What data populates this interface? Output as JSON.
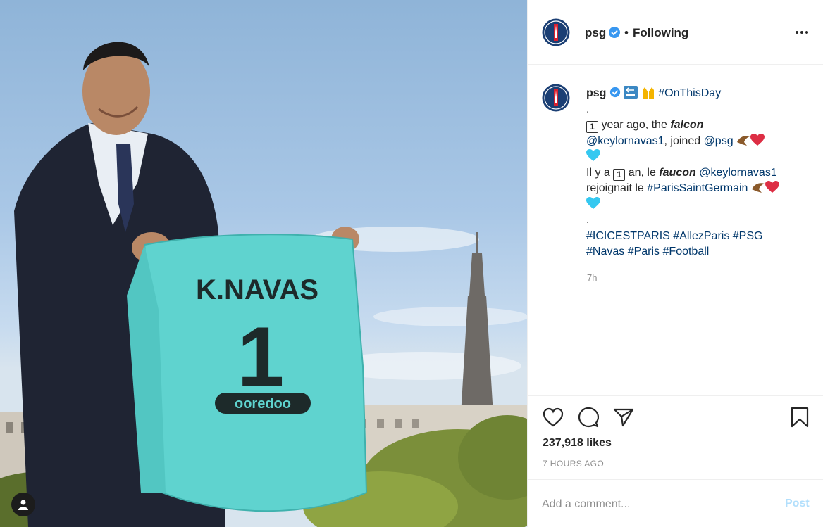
{
  "post": {
    "username": "psg",
    "follow_status": "Following",
    "more_label": "More options",
    "user_tag_label": "Tagged user"
  },
  "photo": {
    "jersey_name": "K.NAVAS",
    "jersey_number": "1",
    "jersey_sponsor": "ooredoo",
    "avatar_text": "PARIS"
  },
  "caption": {
    "username": "psg",
    "back_emoji": "back-arrow-emoji",
    "hands_emoji": "raised-hands-emoji",
    "hashtag_day": "#OnThisDay",
    "dot1": ".",
    "keycap": "1",
    "line2_a": "year ago, the",
    "falcon": "falcon",
    "mention1": "@keylornavas1",
    "line3_b": ", joined",
    "mention_psg": "@psg",
    "fr_a": "Il y a",
    "fr_b": "an, le",
    "faucon": "faucon",
    "mention2": "@keylornavas1",
    "fr_c": "rejoignait le",
    "hashtag_psg_full": "#ParisSaintGermain",
    "dot2": ".",
    "tags_line1": [
      "#ICICESTPARIS",
      "#AllezParis",
      "#PSG"
    ],
    "tags_line2": [
      "#Navas",
      "#Paris",
      "#Football"
    ],
    "time": "7h"
  },
  "actions": {
    "likes": "237,918 likes",
    "posted_ago": "7 HOURS AGO"
  },
  "add_comment": {
    "placeholder": "Add a comment...",
    "post_label": "Post"
  },
  "colors": {
    "link": "#00376b",
    "verified": "#3897f0",
    "post_disabled": "#b2dffc",
    "jersey": "#5fd3cf",
    "psg_navy": "#1b3f74",
    "psg_red": "#d8202f"
  }
}
